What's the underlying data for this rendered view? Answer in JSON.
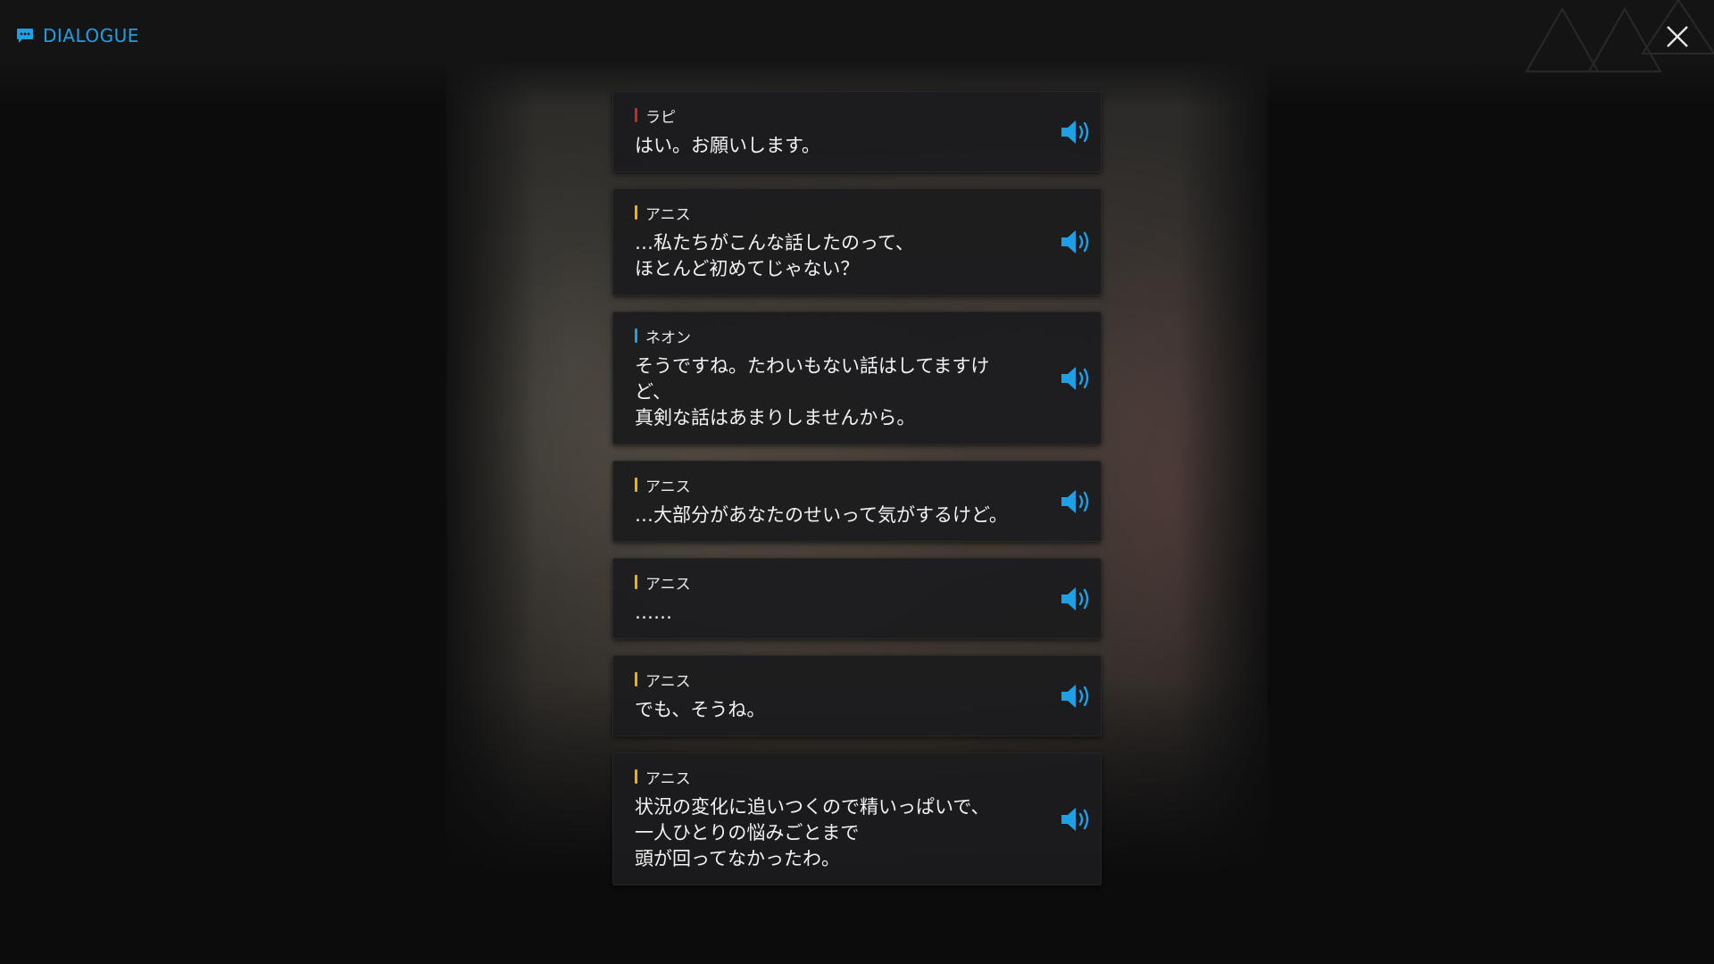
{
  "header": {
    "title": "DIALOGUE",
    "title_icon": "chat-bubble-icon",
    "close_icon": "close-icon"
  },
  "colors": {
    "accent": "#1ea0e6",
    "rapi": "#d0271e",
    "anis": "#f0b400",
    "neon": "#1ea0e6"
  },
  "dialogue": [
    {
      "speaker": "ラピ",
      "speaker_color": "#d0271e",
      "text": "はい。お願いします。",
      "voice_icon": "speaker-icon"
    },
    {
      "speaker": "アニス",
      "speaker_color": "#f0b400",
      "text": "…私たちがこんな話したのって、\nほとんど初めてじゃない？",
      "voice_icon": "speaker-icon"
    },
    {
      "speaker": "ネオン",
      "speaker_color": "#1ea0e6",
      "text": "そうですね。たわいもない話はしてますけど、\n真剣な話はあまりしませんから。",
      "voice_icon": "speaker-icon"
    },
    {
      "speaker": "アニス",
      "speaker_color": "#f0b400",
      "text": "…大部分があなたのせいって気がするけど。",
      "voice_icon": "speaker-icon"
    },
    {
      "speaker": "アニス",
      "speaker_color": "#f0b400",
      "text": "……",
      "voice_icon": "speaker-icon"
    },
    {
      "speaker": "アニス",
      "speaker_color": "#f0b400",
      "text": "でも、そうね。",
      "voice_icon": "speaker-icon"
    },
    {
      "speaker": "アニス",
      "speaker_color": "#f0b400",
      "text": "状況の変化に追いつくので精いっぱいで、\n一人ひとりの悩みごとまで\n頭が回ってなかったわ。",
      "voice_icon": "speaker-icon"
    }
  ]
}
